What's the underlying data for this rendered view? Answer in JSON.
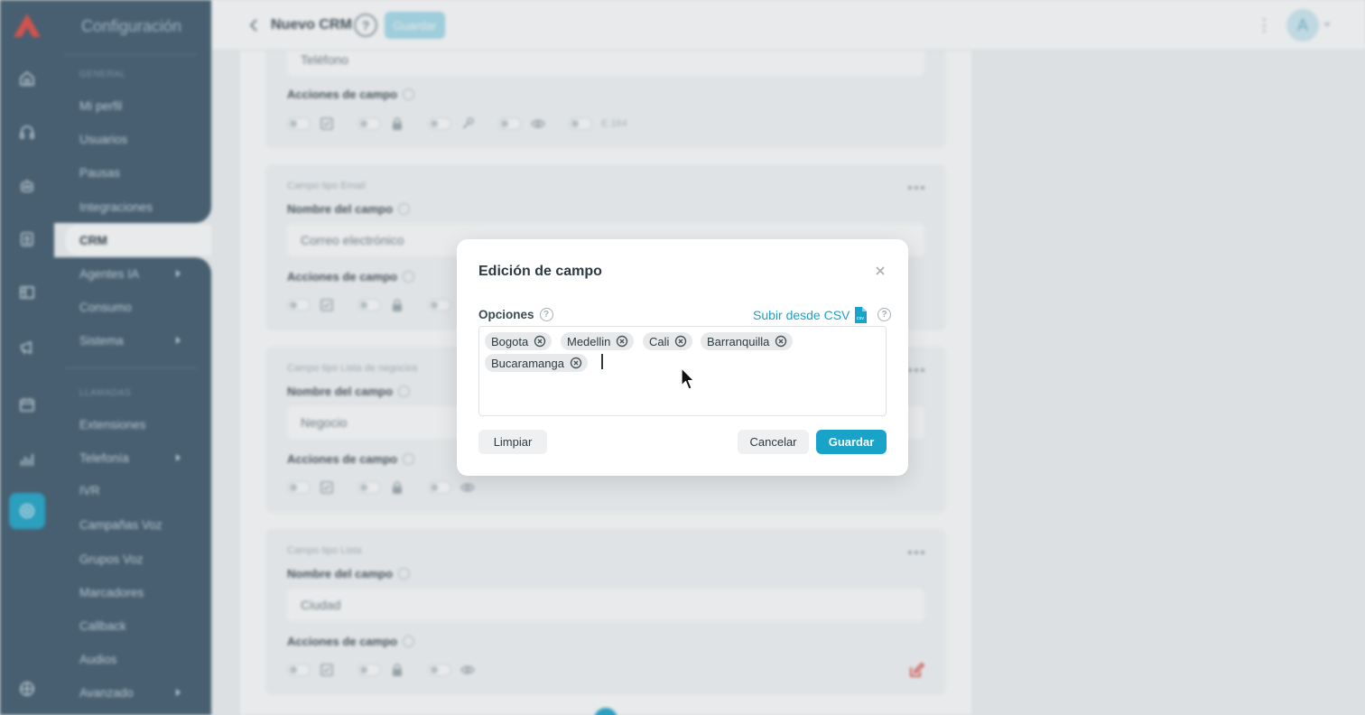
{
  "app": {
    "sidebar": {
      "title": "Configuración",
      "section_general": "GENERAL",
      "section_llamadas": "LLAMADAS",
      "items": [
        {
          "label": "Mi perfil"
        },
        {
          "label": "Usuarios"
        },
        {
          "label": "Pausas"
        },
        {
          "label": "Integraciones"
        },
        {
          "label": "CRM"
        },
        {
          "label": "Agentes IA"
        },
        {
          "label": "Consumo"
        },
        {
          "label": "Sistema"
        },
        {
          "label": "Extensiones"
        },
        {
          "label": "Telefonía"
        },
        {
          "label": "IVR"
        },
        {
          "label": "Campañas Voz"
        },
        {
          "label": "Grupos Voz"
        },
        {
          "label": "Marcadores"
        },
        {
          "label": "Callback"
        },
        {
          "label": "Audios"
        },
        {
          "label": "Avanzado"
        }
      ]
    },
    "topbar": {
      "title": "Nuevo CRM",
      "help": "?",
      "save_label": "Guardar",
      "avatar_letter": "A"
    },
    "cards": [
      {
        "type": "",
        "field_name_label": "",
        "value": "Teléfono",
        "actions_label": "Acciones de campo",
        "extra_label": "E.164"
      },
      {
        "type": "Campo tipo Email",
        "field_name_label": "Nombre del campo",
        "value": "Correo electrónico",
        "actions_label": "Acciones de campo"
      },
      {
        "type": "Campo tipo Lista de negocios",
        "field_name_label": "Nombre del campo",
        "value": "Negocio",
        "actions_label": "Acciones de campo"
      },
      {
        "type": "Campo tipo Lista",
        "field_name_label": "Nombre del campo",
        "value": "Ciudad",
        "actions_label": "Acciones de campo"
      }
    ]
  },
  "modal": {
    "title": "Edición de campo",
    "options_label": "Opciones",
    "help": "?",
    "csv_label": "Subir desde CSV",
    "csv_icon_text": "csv",
    "tags": [
      {
        "label": "Bogota"
      },
      {
        "label": "Medellin"
      },
      {
        "label": "Cali"
      },
      {
        "label": "Barranquilla"
      },
      {
        "label": "Bucaramanga"
      }
    ],
    "clear_label": "Limpiar",
    "cancel_label": "Cancelar",
    "save_label": "Guardar",
    "accent_color": "#1aa3c9"
  }
}
